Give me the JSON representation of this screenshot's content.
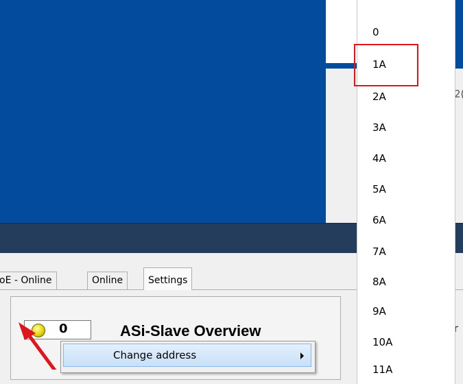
{
  "tabs": [
    {
      "label": "oE - Online"
    },
    {
      "label": "Online"
    },
    {
      "label": "Settings"
    }
  ],
  "slave": {
    "number": "0",
    "led_color": "#f0e020"
  },
  "panel": {
    "title": "ASi-Slave Overview"
  },
  "context_menu": {
    "item_label": "Change address"
  },
  "dropdown": {
    "items": [
      "0",
      "1A",
      "2A",
      "3A",
      "4A",
      "5A",
      "6A",
      "7A",
      "8A",
      "9A",
      "10A",
      "11A"
    ],
    "highlighted": "1A"
  },
  "background_text": {
    "snippet_right": "2(",
    "snippet_right2": "r"
  },
  "colors": {
    "header_blue": "#024b9d",
    "dark_bar": "#253d5c",
    "highlight_red": "#e0151b",
    "arrow_red": "#e0151b"
  }
}
